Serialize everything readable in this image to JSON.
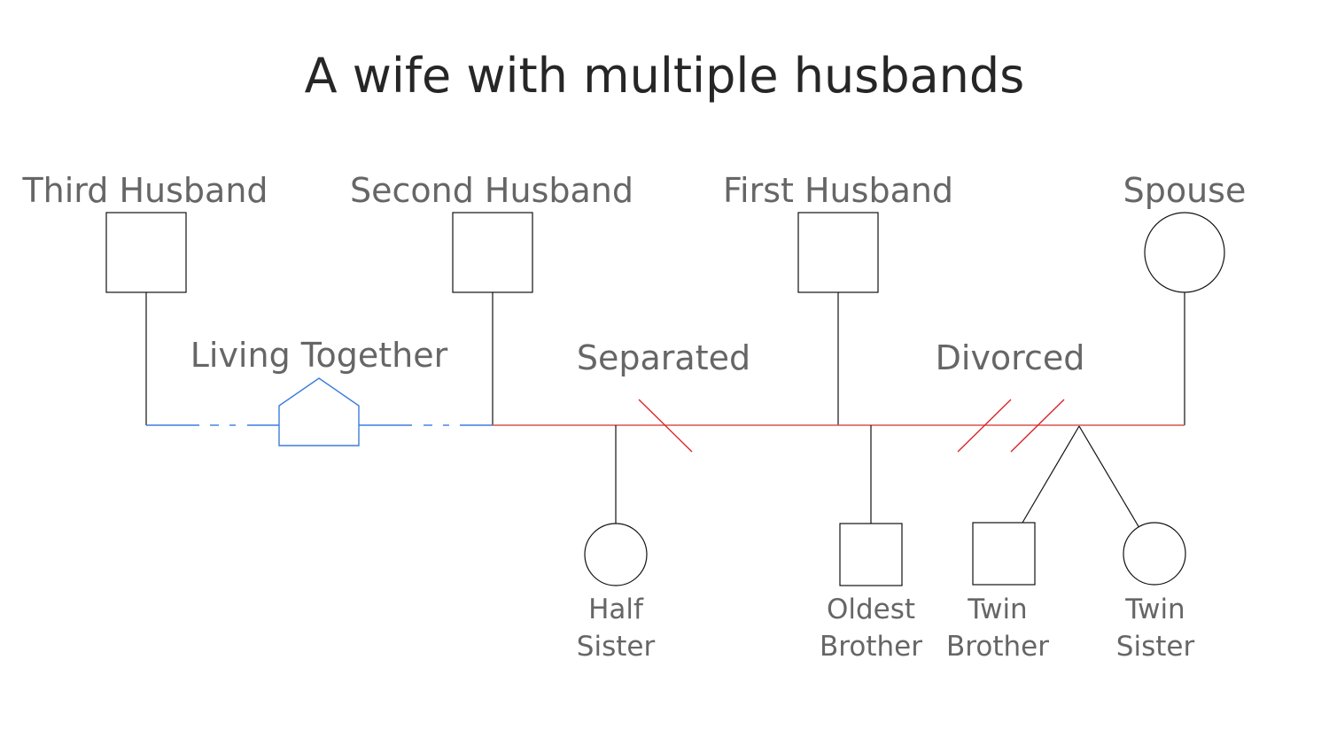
{
  "title": "A wife with multiple husbands",
  "colors": {
    "living_together": "#3b7ddd",
    "marriage_line": "#d9534f",
    "separation_mark": "#d8262b",
    "text": "#666666",
    "title_text": "#262626"
  },
  "people": {
    "third_husband": {
      "label": "Third Husband",
      "sex": "male"
    },
    "second_husband": {
      "label": "Second Husband",
      "sex": "male"
    },
    "first_husband": {
      "label": "First Husband",
      "sex": "male"
    },
    "spouse": {
      "label": "Spouse",
      "sex": "female"
    },
    "half_sister": {
      "label_line1": "Half",
      "label_line2": "Sister",
      "sex": "female"
    },
    "oldest_brother": {
      "label_line1": "Oldest",
      "label_line2": "Brother",
      "sex": "male"
    },
    "twin_brother": {
      "label_line1": "Twin",
      "label_line2": "Brother",
      "sex": "male"
    },
    "twin_sister": {
      "label_line1": "Twin",
      "label_line2": "Sister",
      "sex": "female"
    }
  },
  "relationships": {
    "living_together": {
      "label": "Living Together",
      "between": [
        "Third Husband",
        "Second Husband"
      ],
      "icon": "house-icon"
    },
    "separated": {
      "label": "Separated",
      "between": [
        "Second Husband",
        "First Husband"
      ]
    },
    "divorced": {
      "label": "Divorced",
      "between": [
        "First Husband",
        "Spouse"
      ]
    }
  }
}
